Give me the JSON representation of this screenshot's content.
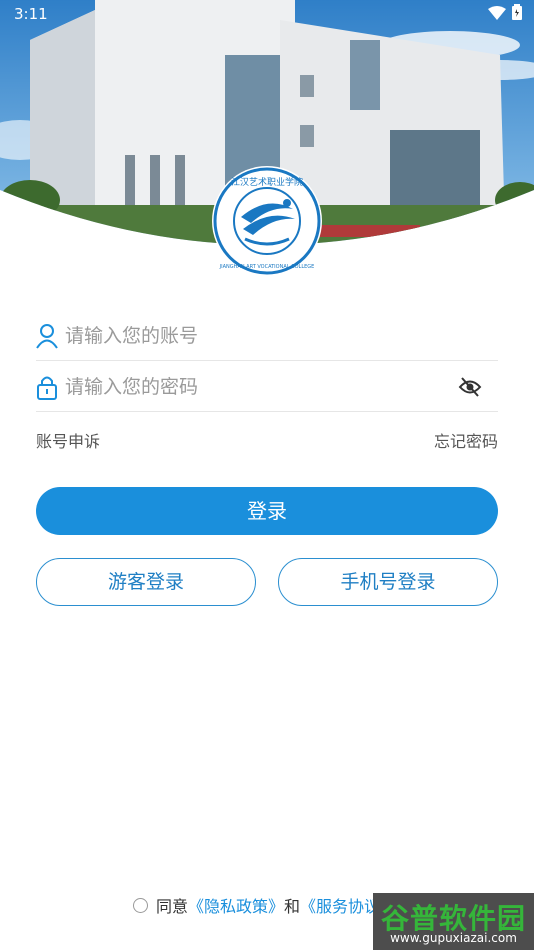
{
  "status": {
    "time": "3:11"
  },
  "logo": {
    "text_top": "江汉艺术职业学院",
    "text_bottom": "JIANGHAN ART VOCATIONAL COLLEGE"
  },
  "form": {
    "account_placeholder": "请输入您的账号",
    "password_placeholder": "请输入您的密码",
    "appeal_label": "账号申诉",
    "forgot_label": "忘记密码"
  },
  "buttons": {
    "login": "登录",
    "guest_login": "游客登录",
    "phone_login": "手机号登录"
  },
  "agreement": {
    "prefix": "同意",
    "privacy": "《隐私政策》",
    "and": "和",
    "service": "《服务协议》"
  },
  "watermark": {
    "brand": "谷普软件园",
    "url": "www.gupuxiazai.com"
  },
  "colors": {
    "primary": "#1a8fdc",
    "outline": "#2b8fd0"
  }
}
